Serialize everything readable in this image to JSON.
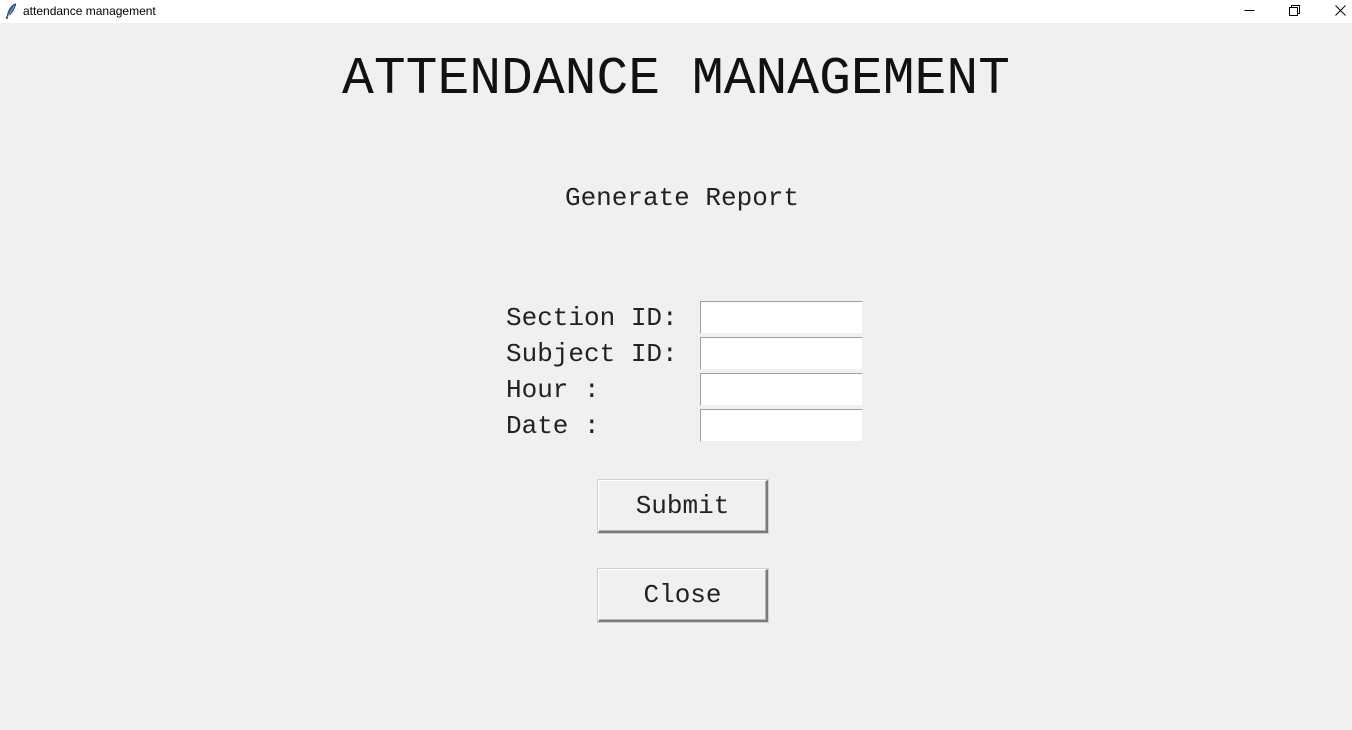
{
  "window": {
    "title": "attendance management",
    "app_icon": "feather-icon",
    "controls": {
      "minimize_icon": "minimize-icon",
      "maximize_icon": "restore-icon",
      "close_icon": "close-icon"
    }
  },
  "app": {
    "heading": "ATTENDANCE MANAGEMENT",
    "subheading": "Generate Report"
  },
  "form": {
    "fields": [
      {
        "label": "Section ID:",
        "value": ""
      },
      {
        "label": "Subject ID:",
        "value": ""
      },
      {
        "label": "Hour :",
        "value": ""
      },
      {
        "label": "Date :",
        "value": ""
      }
    ]
  },
  "buttons": {
    "submit_label": "Submit",
    "close_label": "Close"
  }
}
